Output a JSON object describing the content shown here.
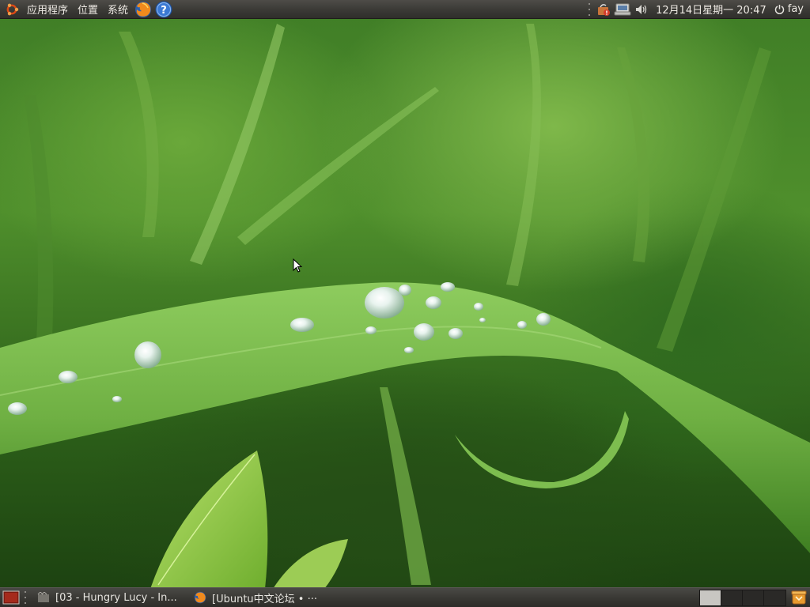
{
  "top_panel": {
    "menus": {
      "applications": "应用程序",
      "places": "位置",
      "system": "系统"
    },
    "launchers": [
      {
        "icon": "firefox-icon"
      },
      {
        "icon": "help-icon"
      }
    ],
    "tray": {
      "icons": [
        "update-notifier-icon",
        "network-icon",
        "volume-icon"
      ],
      "clock": "12月14日星期一 20:47",
      "user": "fay"
    }
  },
  "bottom_panel": {
    "tasks": [
      {
        "icon": "media-player-icon",
        "title": "[03 - Hungry Lucy - In..."
      },
      {
        "icon": "firefox-icon",
        "title": "[Ubuntu中文论坛 • ···"
      }
    ],
    "workspaces": {
      "count": 4,
      "active": 1
    }
  },
  "colors": {
    "panel": "#3c3b37",
    "ubuntu_orange": "#dd4814",
    "active_workspace": "#c8c6c2"
  }
}
